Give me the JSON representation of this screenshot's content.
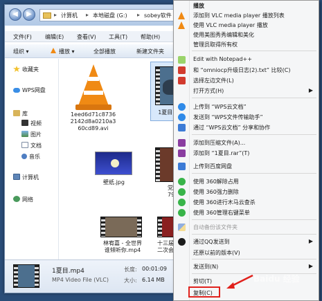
{
  "explorer": {
    "breadcrumb": [
      "计算机",
      "本地磁盘 (G:)",
      "sobey软件"
    ],
    "menu": [
      "文件(F)",
      "编辑(E)",
      "查看(V)",
      "工具(T)",
      "帮助(H)"
    ],
    "toolbar": [
      "组织 ▾",
      "播放 ▾",
      "全部播放",
      "新建文件夹"
    ],
    "nav": [
      "收藏夹",
      "WPS网盘",
      "库",
      "视频",
      "图片",
      "文档",
      "音乐",
      "计算机",
      "网络"
    ],
    "files": [
      {
        "name_line1": "1eed6d71c8736",
        "name_line2": "2142d8a0210a3",
        "name_line3": "60cd89.avi",
        "icon": "vlc-cone-icon"
      },
      {
        "name": "1夏目.mp4",
        "icon": "video-thumbnail"
      },
      {
        "name": "壁纸.jpg",
        "icon": "image-thumbnail"
      },
      {
        "name_line1": "党建t",
        "name_line2": "795.n",
        "icon": "video-thumbnail"
      },
      {
        "name_line1": "林宥嘉 - 全世界",
        "name_line2": "谁倾听你.mp4",
        "icon": "video-thumbnail"
      },
      {
        "name_line1": "十三届全",
        "name_line2": "二次会议",
        "icon": "video-thumbnail"
      }
    ],
    "details": {
      "filename": "1夏目.mp4",
      "type": "MP4 Video File (VLC)",
      "length_label": "长度:",
      "length": "00:01:09",
      "size_label": "大小:",
      "size": "6.14 MB"
    }
  },
  "context_menu": {
    "items": [
      {
        "label": "播放",
        "bold": true,
        "icon": "none"
      },
      {
        "label": "添加到 VLC media player 播放列表",
        "icon": "vlc-icon"
      },
      {
        "label": "使用 VLC media player 播放",
        "icon": "vlc-icon"
      },
      {
        "label": "使用美图秀秀编辑和美化",
        "icon": "none"
      },
      {
        "label": "管理员取得所有权",
        "icon": "none"
      },
      {
        "label": "Edit with Notepad++",
        "icon": "notepad-icon"
      },
      {
        "label": "和 “omniocp升级日志(2).txt” 比较(C)",
        "icon": "compare-icon"
      },
      {
        "label": "选择左边文件(L)",
        "icon": "compare-icon"
      },
      {
        "label": "打开方式(H)",
        "icon": "none",
        "submenu": true
      },
      {
        "label": "上传到 “WPS云文档”",
        "icon": "wps-cloud-icon"
      },
      {
        "label": "发送到 “WPS文件传输助手”",
        "icon": "wps-cloud-icon"
      },
      {
        "label": "通过 “WPS云文档” 分享和协作",
        "icon": "share-icon"
      },
      {
        "label": "添加到压缩文件(A)...",
        "icon": "rar-icon"
      },
      {
        "label": "添加到 “1夏目.rar”(T)",
        "icon": "rar-icon"
      },
      {
        "label": "上传到百度网盘",
        "icon": "baidu-icon"
      },
      {
        "label": "使用 360解除占用",
        "icon": "360-icon"
      },
      {
        "label": "使用 360强力删除",
        "icon": "360-icon"
      },
      {
        "label": "使用 360进行木马云查杀",
        "icon": "360-icon"
      },
      {
        "label": "使用 360管理右键菜单",
        "icon": "360-icon"
      },
      {
        "label": "自动备份该文件夹",
        "icon": "backup-icon",
        "disabled": true
      },
      {
        "label": "通过QQ发送到",
        "icon": "qq-icon",
        "submenu": true
      },
      {
        "label": "还原以前的版本(V)",
        "icon": "none"
      },
      {
        "label": "发送到(N)",
        "icon": "none",
        "submenu": true
      },
      {
        "label": "剪切(T)",
        "icon": "none"
      },
      {
        "label": "复制(C)",
        "icon": "none"
      }
    ]
  },
  "watermark": "Baidu 经验",
  "colors": {
    "accent": "#e0211c",
    "vlc_orange": "#f08a14"
  }
}
